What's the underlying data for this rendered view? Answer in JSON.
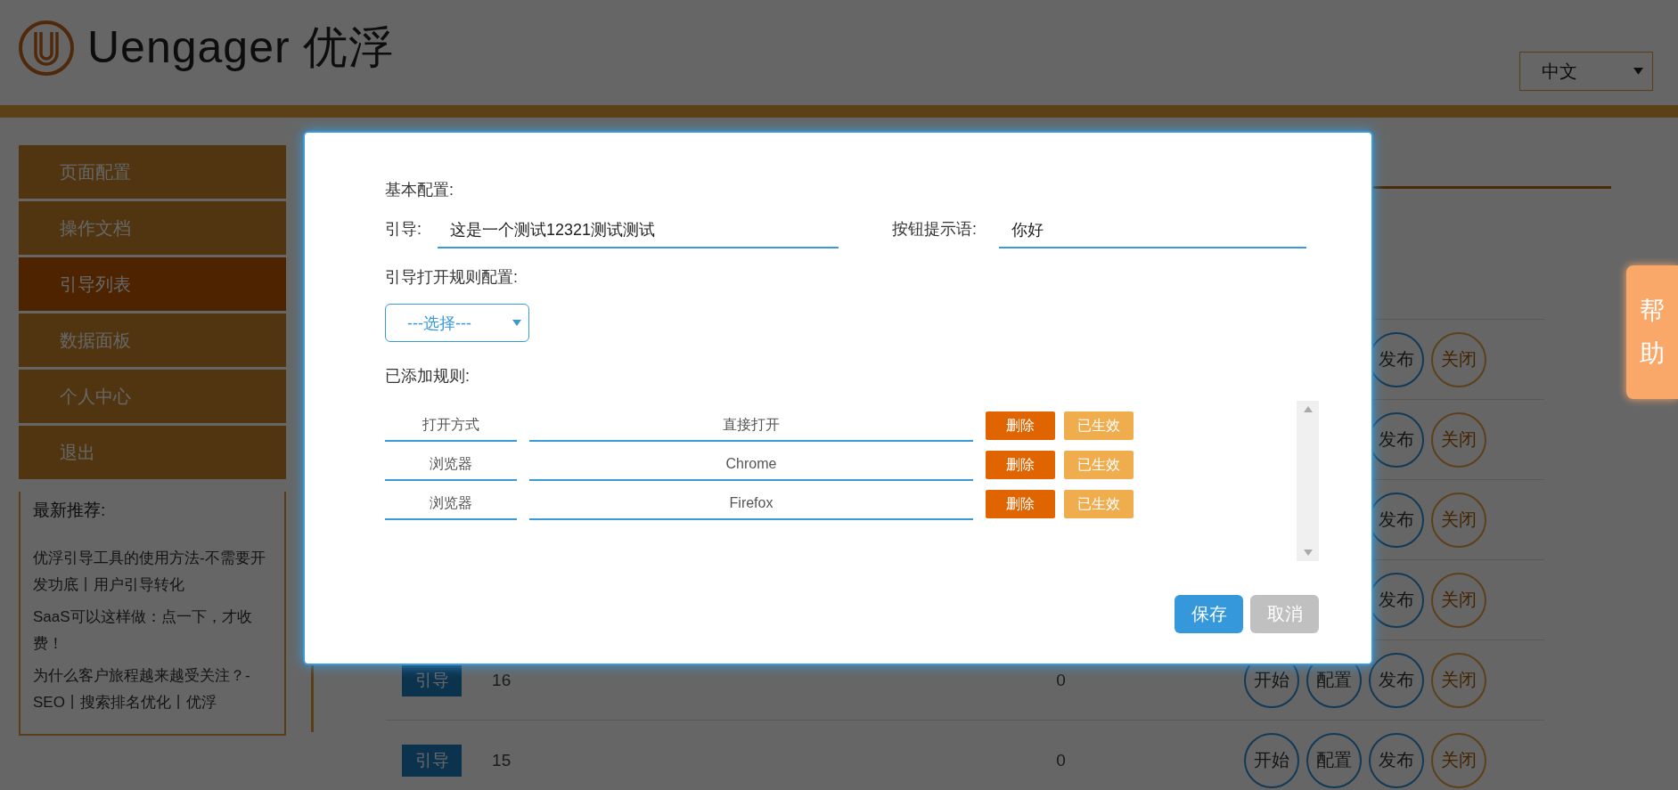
{
  "header": {
    "brand": "Uengager 优浮",
    "language": "中文"
  },
  "sidebar": {
    "items": [
      {
        "label": "页面配置",
        "selected": false
      },
      {
        "label": "操作文档",
        "selected": false
      },
      {
        "label": "引导列表",
        "selected": true
      },
      {
        "label": "数据面板",
        "selected": false
      },
      {
        "label": "个人中心",
        "selected": false
      },
      {
        "label": "退出",
        "selected": false
      }
    ],
    "recommend": {
      "title": "最新推荐:",
      "links": [
        "优浮引导工具的使用方法-不需要开发功底丨用户引导转化",
        "SaaS可以这样做：点一下，才收费！",
        "为什么客户旅程越来越受关注？-SEO丨搜索排名优化丨优浮"
      ]
    }
  },
  "table": {
    "rows": [
      {
        "actions": [
          {
            "label": "发布",
            "kind": "primary"
          },
          {
            "label": "关闭",
            "kind": "warning"
          }
        ]
      },
      {
        "actions": [
          {
            "label": "发布",
            "kind": "primary"
          },
          {
            "label": "关闭",
            "kind": "warning"
          }
        ]
      },
      {
        "actions": [
          {
            "label": "发布",
            "kind": "primary"
          },
          {
            "label": "关闭",
            "kind": "warning"
          }
        ]
      },
      {
        "actions": [
          {
            "label": "发布",
            "kind": "primary"
          },
          {
            "label": "关闭",
            "kind": "warning"
          }
        ]
      },
      {
        "tag": "引导",
        "id": "16",
        "count": "0",
        "actions": [
          {
            "label": "开始",
            "kind": "primary"
          },
          {
            "label": "配置",
            "kind": "primary"
          },
          {
            "label": "发布",
            "kind": "primary"
          },
          {
            "label": "关闭",
            "kind": "warning"
          }
        ]
      },
      {
        "tag": "引导",
        "id": "15",
        "count": "0",
        "actions": [
          {
            "label": "开始",
            "kind": "primary"
          },
          {
            "label": "配置",
            "kind": "primary"
          },
          {
            "label": "发布",
            "kind": "primary"
          },
          {
            "label": "关闭",
            "kind": "warning"
          }
        ]
      }
    ]
  },
  "help_tab": "帮助",
  "modal": {
    "section_title": "基本配置:",
    "guide": {
      "label": "引导:",
      "value": "这是一个测试12321测试测试"
    },
    "hint": {
      "label": "按钮提示语:",
      "value": "你好"
    },
    "rules_config_label": "引导打开规则配置:",
    "select": {
      "value": "---选择---"
    },
    "added_label": "已添加规则:",
    "rules": [
      {
        "type": "打开方式",
        "value": "直接打开",
        "delete": "删除",
        "status": "已生效"
      },
      {
        "type": "浏览器",
        "value": "Chrome",
        "delete": "删除",
        "status": "已生效"
      },
      {
        "type": "浏览器",
        "value": "Firefox",
        "delete": "删除",
        "status": "已生效"
      }
    ],
    "buttons": [
      {
        "label": "保存",
        "kind": "primary"
      },
      {
        "label": "取消",
        "kind": "secondary"
      }
    ]
  }
}
